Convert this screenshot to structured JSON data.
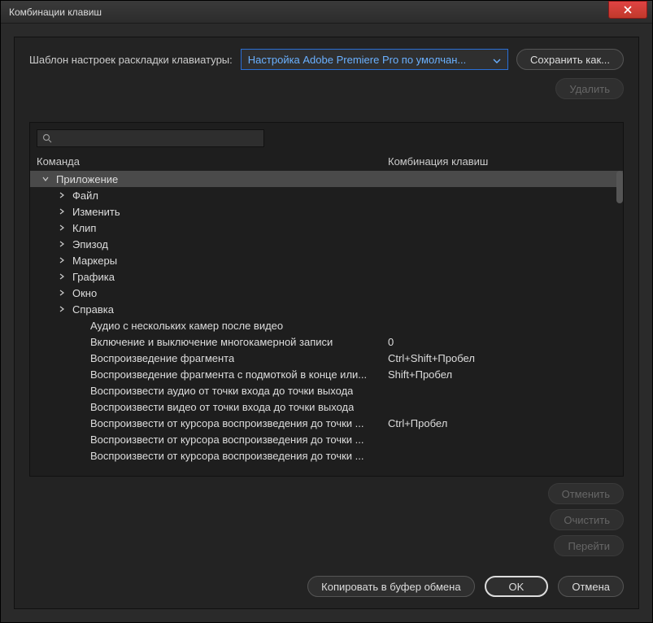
{
  "title": "Комбинации клавиш",
  "layout_label": "Шаблон настроек раскладки клавиатуры:",
  "dropdown_value": "Настройка Adobe Premiere Pro по умолчан...",
  "save_as": "Сохранить как...",
  "delete": "Удалить",
  "columns": {
    "command": "Команда",
    "shortcut": "Комбинация клавиш"
  },
  "search_placeholder": "",
  "rows": [
    {
      "label": "Приложение",
      "indent": 0,
      "arrow": "down",
      "selected": true,
      "shortcut": ""
    },
    {
      "label": "Файл",
      "indent": 1,
      "arrow": "right",
      "shortcut": ""
    },
    {
      "label": "Изменить",
      "indent": 1,
      "arrow": "right",
      "shortcut": ""
    },
    {
      "label": "Клип",
      "indent": 1,
      "arrow": "right",
      "shortcut": ""
    },
    {
      "label": "Эпизод",
      "indent": 1,
      "arrow": "right",
      "shortcut": ""
    },
    {
      "label": "Маркеры",
      "indent": 1,
      "arrow": "right",
      "shortcut": ""
    },
    {
      "label": "Графика",
      "indent": 1,
      "arrow": "right",
      "shortcut": ""
    },
    {
      "label": "Окно",
      "indent": 1,
      "arrow": "right",
      "shortcut": ""
    },
    {
      "label": "Справка",
      "indent": 1,
      "arrow": "right",
      "shortcut": ""
    },
    {
      "label": "Аудио с нескольких камер после видео",
      "indent": 2,
      "arrow": "",
      "shortcut": ""
    },
    {
      "label": "Включение и выключение многокамерной записи",
      "indent": 2,
      "arrow": "",
      "shortcut": "0"
    },
    {
      "label": "Воспроизведение фрагмента",
      "indent": 2,
      "arrow": "",
      "shortcut": "Ctrl+Shift+Пробел"
    },
    {
      "label": "Воспроизведение фрагмента с подмоткой в конце или...",
      "indent": 2,
      "arrow": "",
      "shortcut": "Shift+Пробел"
    },
    {
      "label": "Воспроизвести аудио от точки входа до точки выхода",
      "indent": 2,
      "arrow": "",
      "shortcut": ""
    },
    {
      "label": "Воспроизвести видео от точки входа до точки выхода",
      "indent": 2,
      "arrow": "",
      "shortcut": ""
    },
    {
      "label": "Воспроизвести от курсора воспроизведения до точки ...",
      "indent": 2,
      "arrow": "",
      "shortcut": "Ctrl+Пробел"
    },
    {
      "label": "Воспроизвести от курсора воспроизведения до точки ...",
      "indent": 2,
      "arrow": "",
      "shortcut": ""
    },
    {
      "label": "Воспроизвести от курсора воспроизведения до точки ...",
      "indent": 2,
      "arrow": "",
      "shortcut": ""
    }
  ],
  "side_actions": {
    "undo": "Отменить",
    "clear": "Очистить",
    "goto": "Перейти"
  },
  "bottom": {
    "copy": "Копировать в буфер обмена",
    "ok": "OK",
    "cancel": "Отмена"
  }
}
